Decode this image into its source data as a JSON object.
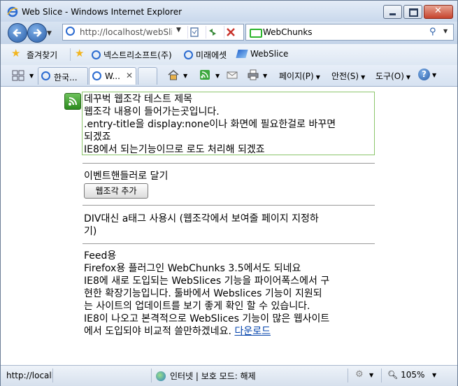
{
  "window": {
    "title": "Web Slice - Windows Internet Explorer"
  },
  "address": {
    "url": "http://localhost/webSlice"
  },
  "search": {
    "provider": "WebChunks"
  },
  "favorites": {
    "label": "즐겨찾기",
    "items": [
      "넥스트리소프트(주)",
      "미래에셋",
      "WebSlice"
    ]
  },
  "tabs": [
    {
      "label": "한국..."
    },
    {
      "label": "W..."
    }
  ],
  "commands": {
    "page": "페이지(P)",
    "safety": "안전(S)",
    "tools": "도구(O)"
  },
  "content": {
    "slice": {
      "title": "데꾸벅 웹조각 테스트 제목",
      "body": "웹조각 내용이 들어가는곳입니다.",
      "note1a": ".entry-title을 display:none이나 화면에 필요한걸로 바꾸면",
      "note1b": "되겠죠",
      "note2": "IE8에서 되는기능이므로 로도 처리해 되겠죠"
    },
    "section2": {
      "text": "이벤트핸들러로 달기",
      "button": "웹조각 추가"
    },
    "section3": {
      "line1": "DIV대신 a태그 사용시 (웹조각에서 보여줄 페이지 지정하",
      "line2": "기)"
    },
    "section4": {
      "heading": "Feed용",
      "line1": "Firefox용 플러그인 WebChunks 3.5에서도 되네요",
      "line2": "IE8에 새로 도입되는 WebSlices 기능을 파이어폭스에서 구",
      "line3": "현한 확장기능입니다. 툴바에서 Webslices 기능이 지원되",
      "line4": "는 사이트의 업데이트를 보기 좋게 확인 할 수 있습니다.",
      "line5": "IE8이 나오고 본격적으로 WebSlices 기능이 많은 웹사이트",
      "line6": "에서 도입되야 비교적 쓸만하겠네요.",
      "link": "다운로드"
    }
  },
  "status": {
    "url": "http://locall",
    "zone": "인터넷 | 보호 모드: 해제",
    "zoom": "105%"
  }
}
